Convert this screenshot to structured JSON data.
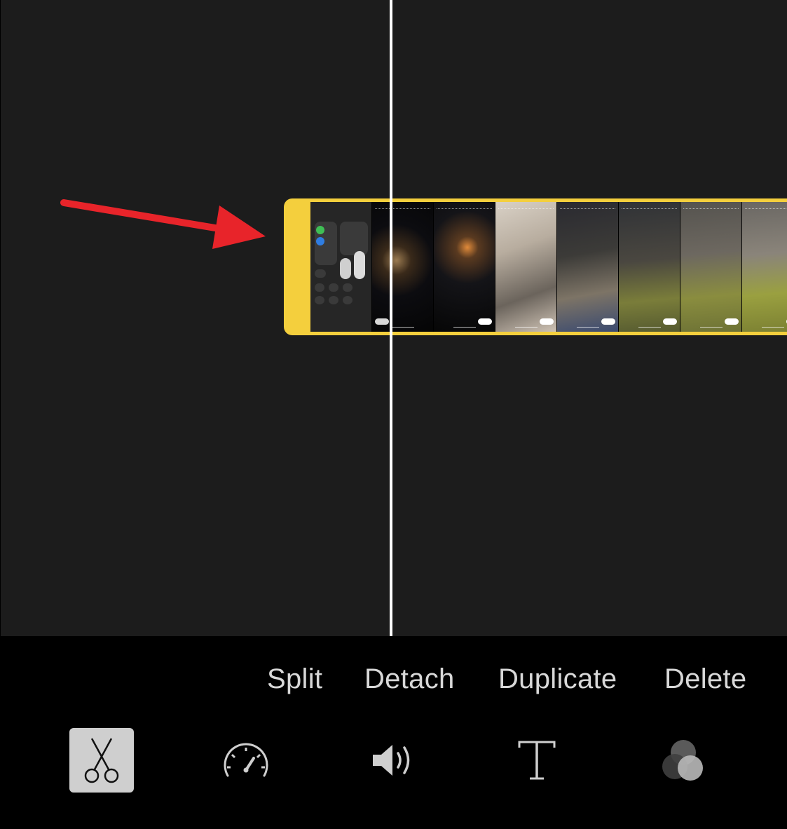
{
  "actions": {
    "split": "Split",
    "detach": "Detach",
    "duplicate": "Duplicate",
    "delete": "Delete"
  },
  "toolbar": {
    "tools": [
      {
        "name": "scissors-icon",
        "active": true
      },
      {
        "name": "speedometer-icon",
        "active": false
      },
      {
        "name": "volume-icon",
        "active": false
      },
      {
        "name": "text-icon",
        "active": false
      },
      {
        "name": "filters-icon",
        "active": false
      }
    ]
  },
  "colors": {
    "clip_border": "#f4cf3d",
    "annotation_arrow": "#e8242a",
    "background": "#1c1c1c"
  }
}
